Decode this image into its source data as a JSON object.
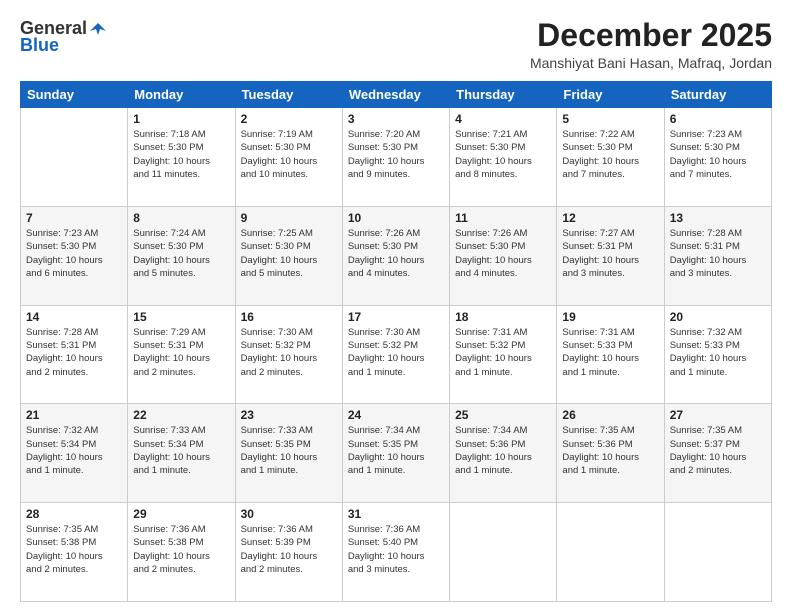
{
  "header": {
    "logo_general": "General",
    "logo_blue": "Blue",
    "month_title": "December 2025",
    "location": "Manshiyat Bani Hasan, Mafraq, Jordan"
  },
  "days_of_week": [
    "Sunday",
    "Monday",
    "Tuesday",
    "Wednesday",
    "Thursday",
    "Friday",
    "Saturday"
  ],
  "weeks": [
    {
      "days": [
        {
          "num": "",
          "info": ""
        },
        {
          "num": "1",
          "info": "Sunrise: 7:18 AM\nSunset: 5:30 PM\nDaylight: 10 hours\nand 11 minutes."
        },
        {
          "num": "2",
          "info": "Sunrise: 7:19 AM\nSunset: 5:30 PM\nDaylight: 10 hours\nand 10 minutes."
        },
        {
          "num": "3",
          "info": "Sunrise: 7:20 AM\nSunset: 5:30 PM\nDaylight: 10 hours\nand 9 minutes."
        },
        {
          "num": "4",
          "info": "Sunrise: 7:21 AM\nSunset: 5:30 PM\nDaylight: 10 hours\nand 8 minutes."
        },
        {
          "num": "5",
          "info": "Sunrise: 7:22 AM\nSunset: 5:30 PM\nDaylight: 10 hours\nand 7 minutes."
        },
        {
          "num": "6",
          "info": "Sunrise: 7:23 AM\nSunset: 5:30 PM\nDaylight: 10 hours\nand 7 minutes."
        }
      ]
    },
    {
      "days": [
        {
          "num": "7",
          "info": "Sunrise: 7:23 AM\nSunset: 5:30 PM\nDaylight: 10 hours\nand 6 minutes."
        },
        {
          "num": "8",
          "info": "Sunrise: 7:24 AM\nSunset: 5:30 PM\nDaylight: 10 hours\nand 5 minutes."
        },
        {
          "num": "9",
          "info": "Sunrise: 7:25 AM\nSunset: 5:30 PM\nDaylight: 10 hours\nand 5 minutes."
        },
        {
          "num": "10",
          "info": "Sunrise: 7:26 AM\nSunset: 5:30 PM\nDaylight: 10 hours\nand 4 minutes."
        },
        {
          "num": "11",
          "info": "Sunrise: 7:26 AM\nSunset: 5:30 PM\nDaylight: 10 hours\nand 4 minutes."
        },
        {
          "num": "12",
          "info": "Sunrise: 7:27 AM\nSunset: 5:31 PM\nDaylight: 10 hours\nand 3 minutes."
        },
        {
          "num": "13",
          "info": "Sunrise: 7:28 AM\nSunset: 5:31 PM\nDaylight: 10 hours\nand 3 minutes."
        }
      ]
    },
    {
      "days": [
        {
          "num": "14",
          "info": "Sunrise: 7:28 AM\nSunset: 5:31 PM\nDaylight: 10 hours\nand 2 minutes."
        },
        {
          "num": "15",
          "info": "Sunrise: 7:29 AM\nSunset: 5:31 PM\nDaylight: 10 hours\nand 2 minutes."
        },
        {
          "num": "16",
          "info": "Sunrise: 7:30 AM\nSunset: 5:32 PM\nDaylight: 10 hours\nand 2 minutes."
        },
        {
          "num": "17",
          "info": "Sunrise: 7:30 AM\nSunset: 5:32 PM\nDaylight: 10 hours\nand 1 minute."
        },
        {
          "num": "18",
          "info": "Sunrise: 7:31 AM\nSunset: 5:32 PM\nDaylight: 10 hours\nand 1 minute."
        },
        {
          "num": "19",
          "info": "Sunrise: 7:31 AM\nSunset: 5:33 PM\nDaylight: 10 hours\nand 1 minute."
        },
        {
          "num": "20",
          "info": "Sunrise: 7:32 AM\nSunset: 5:33 PM\nDaylight: 10 hours\nand 1 minute."
        }
      ]
    },
    {
      "days": [
        {
          "num": "21",
          "info": "Sunrise: 7:32 AM\nSunset: 5:34 PM\nDaylight: 10 hours\nand 1 minute."
        },
        {
          "num": "22",
          "info": "Sunrise: 7:33 AM\nSunset: 5:34 PM\nDaylight: 10 hours\nand 1 minute."
        },
        {
          "num": "23",
          "info": "Sunrise: 7:33 AM\nSunset: 5:35 PM\nDaylight: 10 hours\nand 1 minute."
        },
        {
          "num": "24",
          "info": "Sunrise: 7:34 AM\nSunset: 5:35 PM\nDaylight: 10 hours\nand 1 minute."
        },
        {
          "num": "25",
          "info": "Sunrise: 7:34 AM\nSunset: 5:36 PM\nDaylight: 10 hours\nand 1 minute."
        },
        {
          "num": "26",
          "info": "Sunrise: 7:35 AM\nSunset: 5:36 PM\nDaylight: 10 hours\nand 1 minute."
        },
        {
          "num": "27",
          "info": "Sunrise: 7:35 AM\nSunset: 5:37 PM\nDaylight: 10 hours\nand 2 minutes."
        }
      ]
    },
    {
      "days": [
        {
          "num": "28",
          "info": "Sunrise: 7:35 AM\nSunset: 5:38 PM\nDaylight: 10 hours\nand 2 minutes."
        },
        {
          "num": "29",
          "info": "Sunrise: 7:36 AM\nSunset: 5:38 PM\nDaylight: 10 hours\nand 2 minutes."
        },
        {
          "num": "30",
          "info": "Sunrise: 7:36 AM\nSunset: 5:39 PM\nDaylight: 10 hours\nand 2 minutes."
        },
        {
          "num": "31",
          "info": "Sunrise: 7:36 AM\nSunset: 5:40 PM\nDaylight: 10 hours\nand 3 minutes."
        },
        {
          "num": "",
          "info": ""
        },
        {
          "num": "",
          "info": ""
        },
        {
          "num": "",
          "info": ""
        }
      ]
    }
  ]
}
